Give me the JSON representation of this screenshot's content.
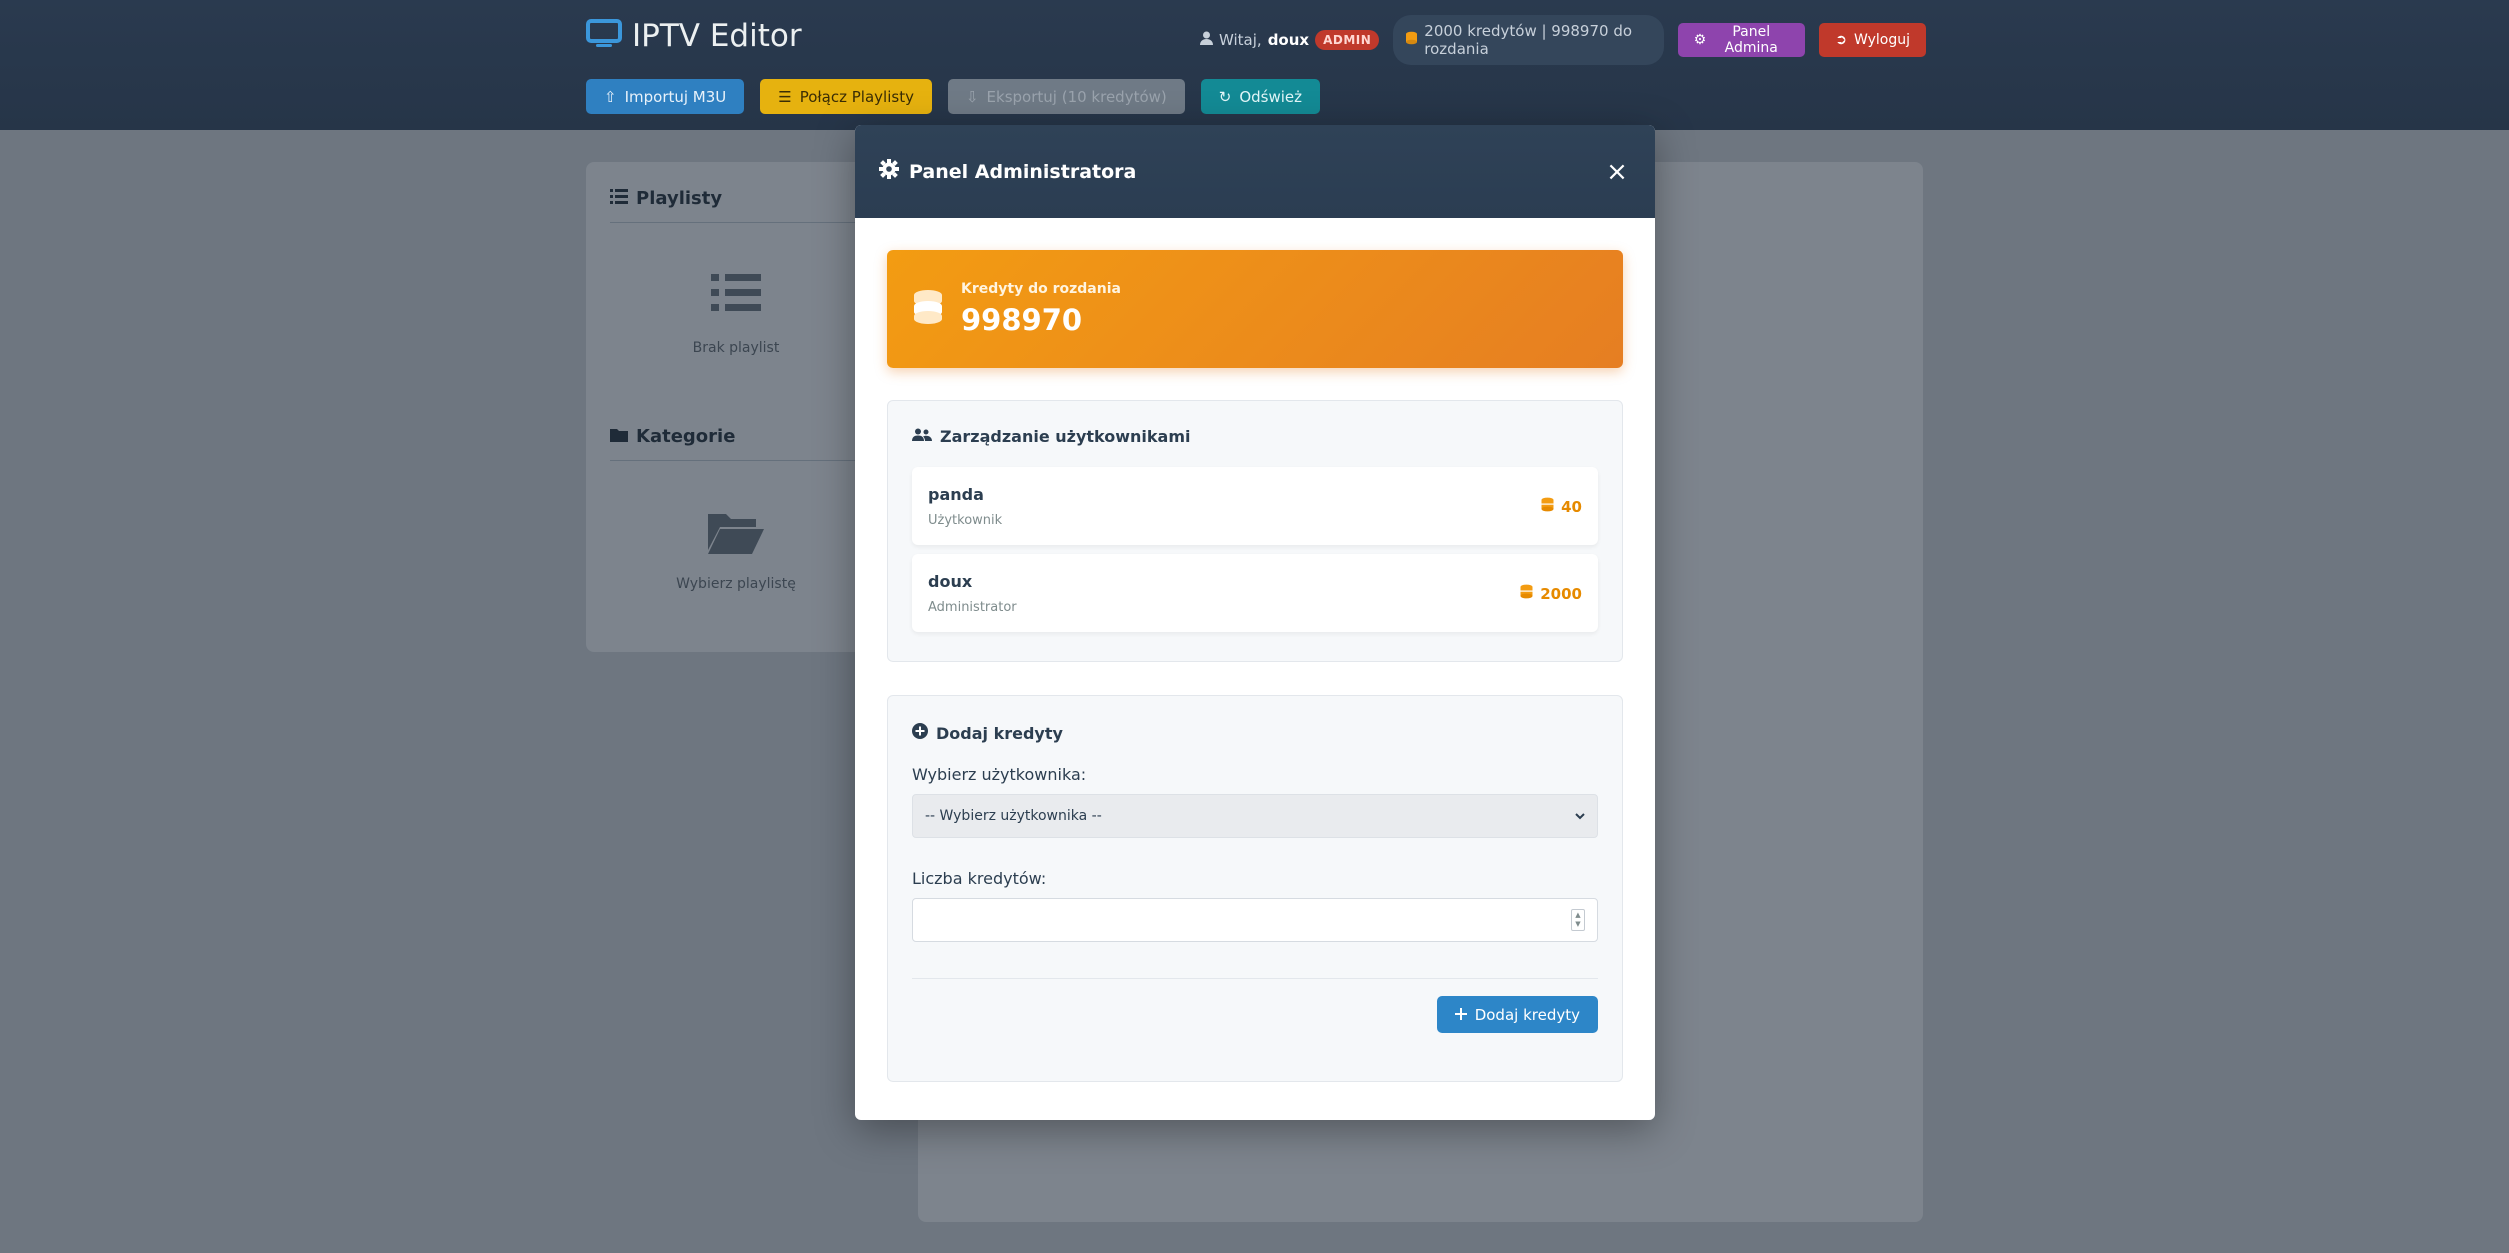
{
  "header": {
    "app_title": "IPTV Editor",
    "welcome_label": "Witaj,",
    "username": "doux",
    "role_badge": "ADMIN",
    "credits_summary": "2000 kredytów | 998970 do rozdania",
    "admin_panel_label": "Panel Admina",
    "logout_label": "Wyloguj"
  },
  "toolbar": {
    "import_label": "Importuj M3U",
    "merge_label": "Połącz Playlisty",
    "export_label": "Eksportuj (10 kredytów)",
    "refresh_label": "Odśwież"
  },
  "sidebar": {
    "playlists_title": "Playlisty",
    "playlists_empty": "Brak playlist",
    "categories_title": "Kategorie",
    "categories_empty": "Wybierz playlistę"
  },
  "modal": {
    "title": "Panel Administratora",
    "close_symbol": "×",
    "credits_card": {
      "label": "Kredyty do rozdania",
      "value": "998970"
    },
    "users_section": {
      "title": "Zarządzanie użytkownikami",
      "users": [
        {
          "name": "panda",
          "role": "Użytkownik",
          "credits": "40"
        },
        {
          "name": "doux",
          "role": "Administrator",
          "credits": "2000"
        }
      ]
    },
    "add_credits_section": {
      "title": "Dodaj kredyty",
      "user_select_label": "Wybierz użytkownika:",
      "user_select_value": "-- Wybierz użytkownika --",
      "amount_label": "Liczba kredytów:",
      "amount_value": "",
      "submit_label": "Dodaj kredyty"
    }
  },
  "colors": {
    "header_bg": "#2a3a4f",
    "accent_orange": "#f39c12",
    "primary_blue": "#2d86c8",
    "admin_purple": "#8e44ad",
    "danger_red": "#c0392b"
  },
  "icons": {
    "brand": "tv-icon",
    "user": "user-icon",
    "coins": "coins-icon",
    "cog": "cog-icon",
    "logout": "logout-icon",
    "upload": "upload-icon",
    "layers": "layers-icon",
    "download": "download-icon",
    "refresh": "refresh-icon",
    "list": "list-icon",
    "folder": "folder-icon",
    "users": "users-icon",
    "plus_circle": "plus-circle-icon",
    "plus": "plus-icon"
  }
}
